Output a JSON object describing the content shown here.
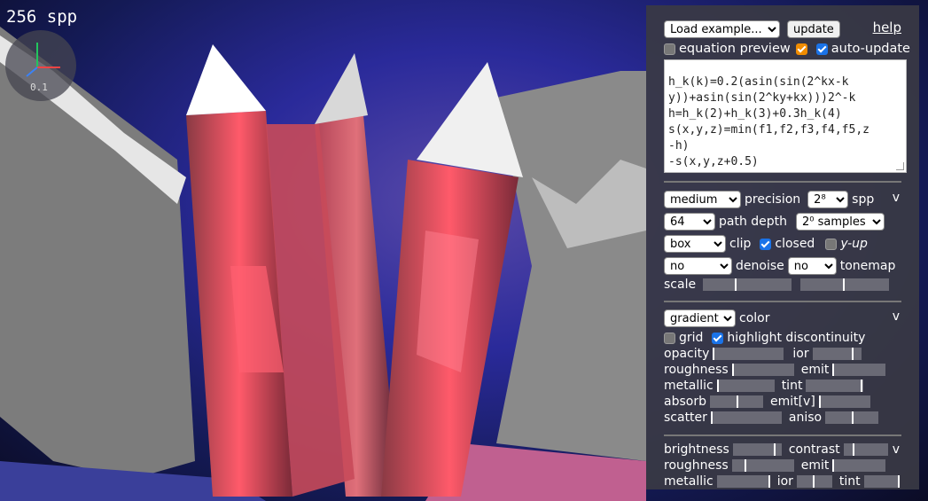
{
  "spp_overlay": "256 spp",
  "axis_scale": "0.1",
  "controls": {
    "load_example": "Load example...",
    "update": "update",
    "help": "help",
    "equation_preview": "equation preview",
    "equation_preview_checked": false,
    "auto_update": "auto-update",
    "auto_update_checked": true
  },
  "editor_lines": [
    "h_k(k)=0.2(asin(sin(2^kx-k",
    "y))+asin(sin(2^ky+kx)))2^-k",
    "h=h_k(2)+h_k(3)+0.3h_k(4)",
    "s(x,y,z)=min(f1,f2,f3,f4,f5,z",
    "-h)",
    "-s(x,y,z+0.5)"
  ],
  "render": {
    "precision_value": "medium",
    "precision_label": "precision",
    "spp_value": "2⁸",
    "spp_label": "spp",
    "collapse": "v",
    "path_depth_value": "64",
    "path_depth_label": "path depth",
    "samples_value": "2⁰ samples",
    "clip_value": "box",
    "clip_label": "clip",
    "closed_label": "closed",
    "closed_checked": true,
    "yup_label": "y-up",
    "yup_checked": false,
    "denoise_value": "no",
    "denoise_label": "denoise",
    "tonemap_value": "no",
    "tonemap_label": "tonemap",
    "scale_label": "scale"
  },
  "material": {
    "color_value": "gradient",
    "color_label": "color",
    "collapse": "v",
    "grid_label": "grid",
    "grid_checked": false,
    "highlight_label": "highlight discontinuity",
    "highlight_checked": true,
    "opacity": "opacity",
    "ior": "ior",
    "roughness": "roughness",
    "emit": "emit",
    "metallic": "metallic",
    "tint": "tint",
    "absorb": "absorb",
    "emit_v": "emit[v]",
    "scatter": "scatter",
    "aniso": "aniso"
  },
  "lighting": {
    "brightness": "brightness",
    "contrast": "contrast",
    "collapse": "v",
    "roughness": "roughness",
    "emit": "emit",
    "metallic": "metallic",
    "ior": "ior",
    "tint": "tint"
  }
}
